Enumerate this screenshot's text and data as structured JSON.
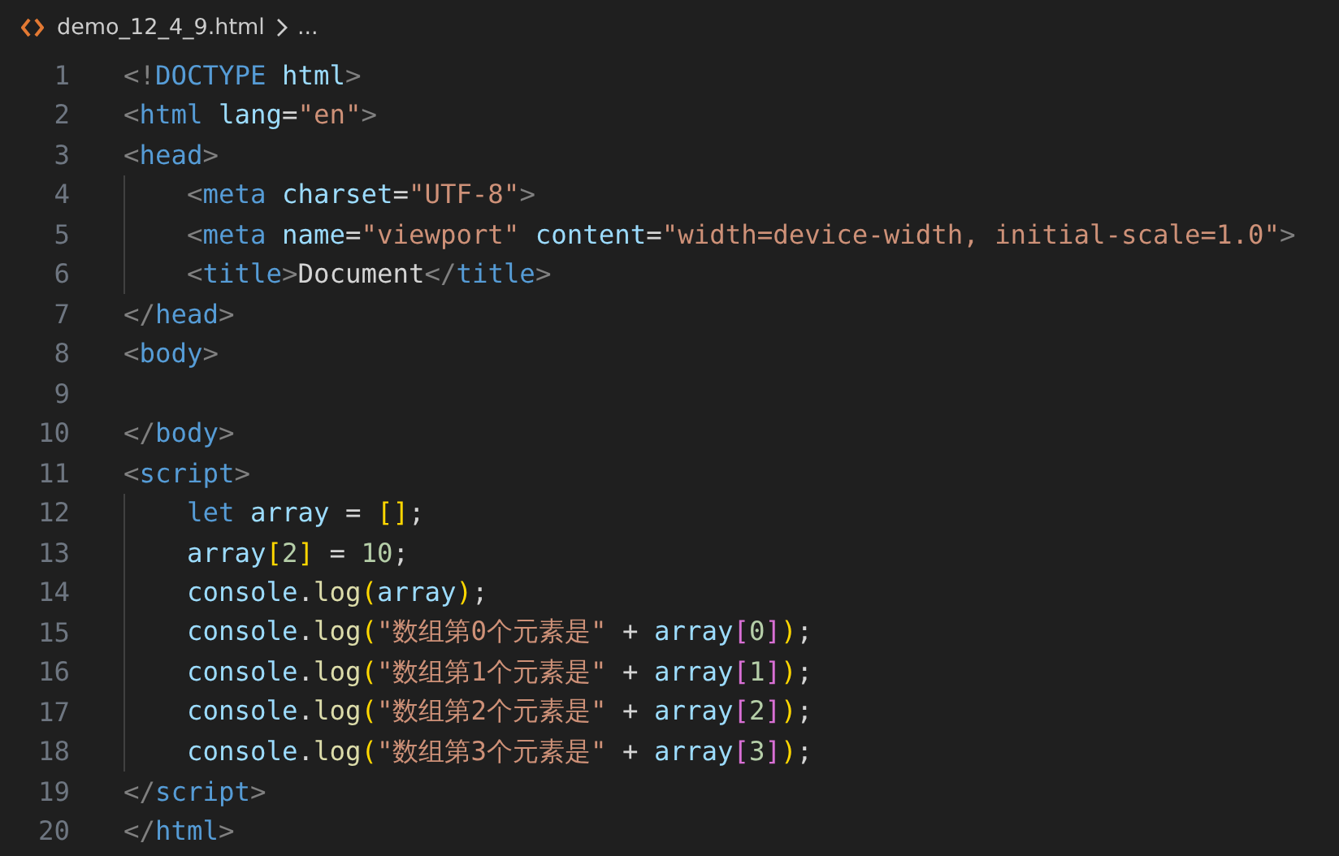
{
  "breadcrumb": {
    "file": "demo_12_4_9.html",
    "more": "..."
  },
  "lines": [
    {
      "number": "1",
      "tokens": [
        {
          "kind": "punct",
          "text": "<!"
        },
        {
          "kind": "tag",
          "text": "DOCTYPE"
        },
        {
          "kind": "attr",
          "text": " html"
        },
        {
          "kind": "punct",
          "text": ">"
        }
      ]
    },
    {
      "number": "2",
      "tokens": [
        {
          "kind": "punct",
          "text": "<"
        },
        {
          "kind": "tag",
          "text": "html"
        },
        {
          "kind": "attr",
          "text": " lang"
        },
        {
          "kind": "plain",
          "text": "="
        },
        {
          "kind": "string",
          "text": "\"en\""
        },
        {
          "kind": "punct",
          "text": ">"
        }
      ]
    },
    {
      "number": "3",
      "tokens": [
        {
          "kind": "punct",
          "text": "<"
        },
        {
          "kind": "tag",
          "text": "head"
        },
        {
          "kind": "punct",
          "text": ">"
        }
      ],
      "children": [
        {
          "number": "4",
          "tokens": [
            {
              "kind": "punct",
              "text": "<"
            },
            {
              "kind": "tag",
              "text": "meta"
            },
            {
              "kind": "attr",
              "text": " charset"
            },
            {
              "kind": "plain",
              "text": "="
            },
            {
              "kind": "string",
              "text": "\"UTF-8\""
            },
            {
              "kind": "punct",
              "text": ">"
            }
          ]
        },
        {
          "number": "5",
          "tokens": [
            {
              "kind": "punct",
              "text": "<"
            },
            {
              "kind": "tag",
              "text": "meta"
            },
            {
              "kind": "attr",
              "text": " name"
            },
            {
              "kind": "plain",
              "text": "="
            },
            {
              "kind": "string",
              "text": "\"viewport\""
            },
            {
              "kind": "attr",
              "text": " content"
            },
            {
              "kind": "plain",
              "text": "="
            },
            {
              "kind": "string",
              "text": "\"width=device-width, initial-scale=1.0\""
            },
            {
              "kind": "punct",
              "text": ">"
            }
          ]
        },
        {
          "number": "6",
          "tokens": [
            {
              "kind": "punct",
              "text": "<"
            },
            {
              "kind": "tag",
              "text": "title"
            },
            {
              "kind": "punct",
              "text": ">"
            },
            {
              "kind": "plain",
              "text": "Document"
            },
            {
              "kind": "punct",
              "text": "</"
            },
            {
              "kind": "tag",
              "text": "title"
            },
            {
              "kind": "punct",
              "text": ">"
            }
          ]
        }
      ]
    },
    {
      "number": "7",
      "tokens": [
        {
          "kind": "punct",
          "text": "</"
        },
        {
          "kind": "tag",
          "text": "head"
        },
        {
          "kind": "punct",
          "text": ">"
        }
      ]
    },
    {
      "number": "8",
      "tokens": [
        {
          "kind": "punct",
          "text": "<"
        },
        {
          "kind": "tag",
          "text": "body"
        },
        {
          "kind": "punct",
          "text": ">"
        }
      ]
    },
    {
      "number": "9"
    },
    {
      "number": "10",
      "tokens": [
        {
          "kind": "punct",
          "text": "</"
        },
        {
          "kind": "tag",
          "text": "body"
        },
        {
          "kind": "punct",
          "text": ">"
        }
      ]
    },
    {
      "number": "11",
      "tokens": [
        {
          "kind": "punct",
          "text": "<"
        },
        {
          "kind": "tag",
          "text": "script"
        },
        {
          "kind": "punct",
          "text": ">"
        }
      ],
      "children": [
        {
          "number": "12",
          "tokens": [
            {
              "kind": "keyword",
              "text": "let"
            },
            {
              "kind": "var",
              "text": " array"
            },
            {
              "kind": "plain",
              "text": " = "
            },
            {
              "kind": "bracket1",
              "text": "[]"
            },
            {
              "kind": "plain",
              "text": ";"
            }
          ]
        },
        {
          "number": "13",
          "tokens": [
            {
              "kind": "var",
              "text": "array"
            },
            {
              "kind": "bracket1",
              "text": "["
            },
            {
              "kind": "number",
              "text": "2"
            },
            {
              "kind": "bracket1",
              "text": "]"
            },
            {
              "kind": "plain",
              "text": " = "
            },
            {
              "kind": "number",
              "text": "10"
            },
            {
              "kind": "plain",
              "text": ";"
            }
          ]
        },
        {
          "number": "14",
          "tokens": [
            {
              "kind": "var",
              "text": "console"
            },
            {
              "kind": "plain",
              "text": "."
            },
            {
              "kind": "func",
              "text": "log"
            },
            {
              "kind": "bracket1",
              "text": "("
            },
            {
              "kind": "var",
              "text": "array"
            },
            {
              "kind": "bracket1",
              "text": ")"
            },
            {
              "kind": "plain",
              "text": ";"
            }
          ]
        },
        {
          "number": "15",
          "tokens": [
            {
              "kind": "var",
              "text": "console"
            },
            {
              "kind": "plain",
              "text": "."
            },
            {
              "kind": "func",
              "text": "log"
            },
            {
              "kind": "bracket1",
              "text": "("
            },
            {
              "kind": "string",
              "text": "\"数组第0个元素是\""
            },
            {
              "kind": "plain",
              "text": " + "
            },
            {
              "kind": "var",
              "text": "array"
            },
            {
              "kind": "bracket2",
              "text": "["
            },
            {
              "kind": "number",
              "text": "0"
            },
            {
              "kind": "bracket2",
              "text": "]"
            },
            {
              "kind": "bracket1",
              "text": ")"
            },
            {
              "kind": "plain",
              "text": ";"
            }
          ]
        },
        {
          "number": "16",
          "tokens": [
            {
              "kind": "var",
              "text": "console"
            },
            {
              "kind": "plain",
              "text": "."
            },
            {
              "kind": "func",
              "text": "log"
            },
            {
              "kind": "bracket1",
              "text": "("
            },
            {
              "kind": "string",
              "text": "\"数组第1个元素是\""
            },
            {
              "kind": "plain",
              "text": " + "
            },
            {
              "kind": "var",
              "text": "array"
            },
            {
              "kind": "bracket2",
              "text": "["
            },
            {
              "kind": "number",
              "text": "1"
            },
            {
              "kind": "bracket2",
              "text": "]"
            },
            {
              "kind": "bracket1",
              "text": ")"
            },
            {
              "kind": "plain",
              "text": ";"
            }
          ]
        },
        {
          "number": "17",
          "tokens": [
            {
              "kind": "var",
              "text": "console"
            },
            {
              "kind": "plain",
              "text": "."
            },
            {
              "kind": "func",
              "text": "log"
            },
            {
              "kind": "bracket1",
              "text": "("
            },
            {
              "kind": "string",
              "text": "\"数组第2个元素是\""
            },
            {
              "kind": "plain",
              "text": " + "
            },
            {
              "kind": "var",
              "text": "array"
            },
            {
              "kind": "bracket2",
              "text": "["
            },
            {
              "kind": "number",
              "text": "2"
            },
            {
              "kind": "bracket2",
              "text": "]"
            },
            {
              "kind": "bracket1",
              "text": ")"
            },
            {
              "kind": "plain",
              "text": ";"
            }
          ]
        },
        {
          "number": "18",
          "tokens": [
            {
              "kind": "var",
              "text": "console"
            },
            {
              "kind": "plain",
              "text": "."
            },
            {
              "kind": "func",
              "text": "log"
            },
            {
              "kind": "bracket1",
              "text": "("
            },
            {
              "kind": "string",
              "text": "\"数组第3个元素是\""
            },
            {
              "kind": "plain",
              "text": " + "
            },
            {
              "kind": "var",
              "text": "array"
            },
            {
              "kind": "bracket2",
              "text": "["
            },
            {
              "kind": "number",
              "text": "3"
            },
            {
              "kind": "bracket2",
              "text": "]"
            },
            {
              "kind": "bracket1",
              "text": ")"
            },
            {
              "kind": "plain",
              "text": ";"
            }
          ]
        }
      ]
    },
    {
      "number": "19",
      "tokens": [
        {
          "kind": "punct",
          "text": "</"
        },
        {
          "kind": "tag",
          "text": "script"
        },
        {
          "kind": "punct",
          "text": ">"
        }
      ]
    },
    {
      "number": "20",
      "tokens": [
        {
          "kind": "punct",
          "text": "</"
        },
        {
          "kind": "tag",
          "text": "html"
        },
        {
          "kind": "punct",
          "text": ">"
        }
      ]
    }
  ]
}
